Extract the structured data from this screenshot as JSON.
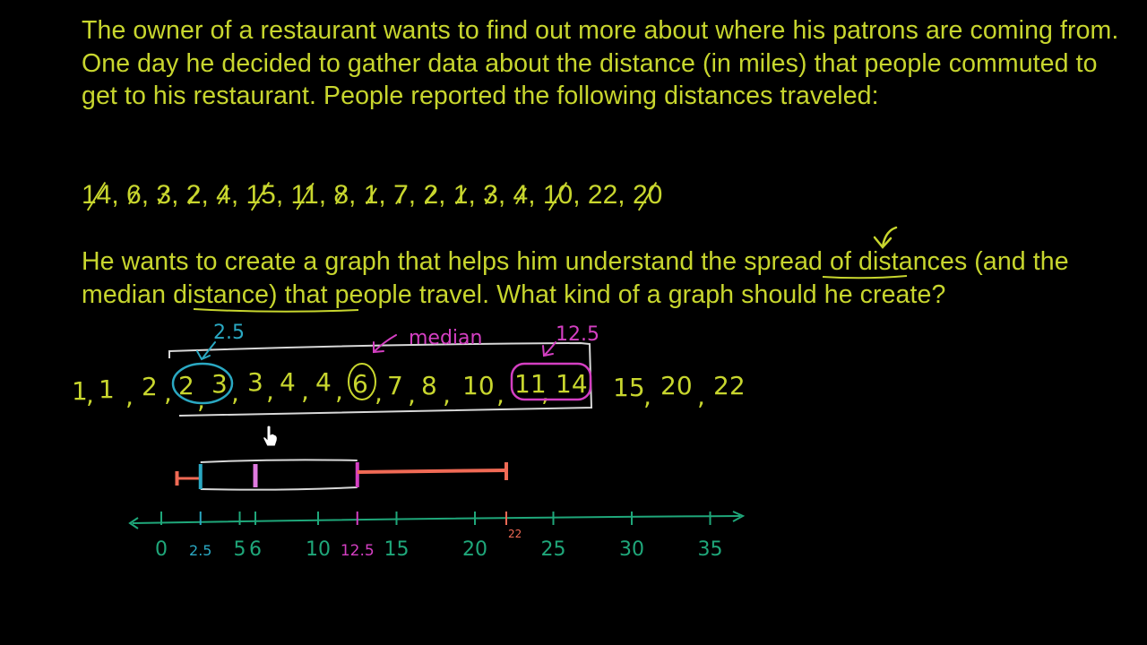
{
  "problem": {
    "intro": "The owner of a restaurant wants to find out more about where his patrons are coming from. One day he decided to gather data about the distance (in miles) that people commuted to get to his restaurant. People reported the following distances traveled:",
    "data": [
      "14",
      "6",
      "3",
      "2",
      "4",
      "15",
      "11",
      "8",
      "1",
      "7",
      "2",
      "1",
      "3",
      "4",
      "10",
      "22",
      "20"
    ],
    "question_parts": {
      "p1": "He wants to create a graph that helps him understand the ",
      "spread": "spread",
      "p2": " of distances (and the ",
      "median": "median distance",
      "p3": ") that people travel. What kind of a graph should he create?"
    }
  },
  "annotations": {
    "median_label": "median",
    "q1_label": "2.5",
    "q3_label": "12.5"
  },
  "sorted_data": [
    "1",
    "1",
    "2",
    "2",
    "3",
    "3",
    "4",
    "4",
    "6",
    "7",
    "8",
    "10",
    "11",
    "14",
    "15",
    "20",
    "22"
  ],
  "number_line": {
    "labels": [
      "0",
      "2.5",
      "5",
      "6",
      "10",
      "12.5",
      "15",
      "20",
      "22",
      "25",
      "30",
      "35"
    ]
  },
  "chart_data": {
    "type": "box",
    "min": 1,
    "q1": 2.5,
    "median": 6,
    "q3": 12.5,
    "max": 22,
    "axis_ticks": [
      0,
      2.5,
      5,
      6,
      10,
      12.5,
      15,
      20,
      22,
      25,
      30,
      35
    ]
  },
  "colors": {
    "text": "#c8d62e",
    "axis": "#1fa77a",
    "q1": "#2aa8c2",
    "q3": "#d43fc2",
    "median_box": "#e07ae0",
    "whisker": "#f06a55",
    "bracket": "#d8d8d8"
  }
}
